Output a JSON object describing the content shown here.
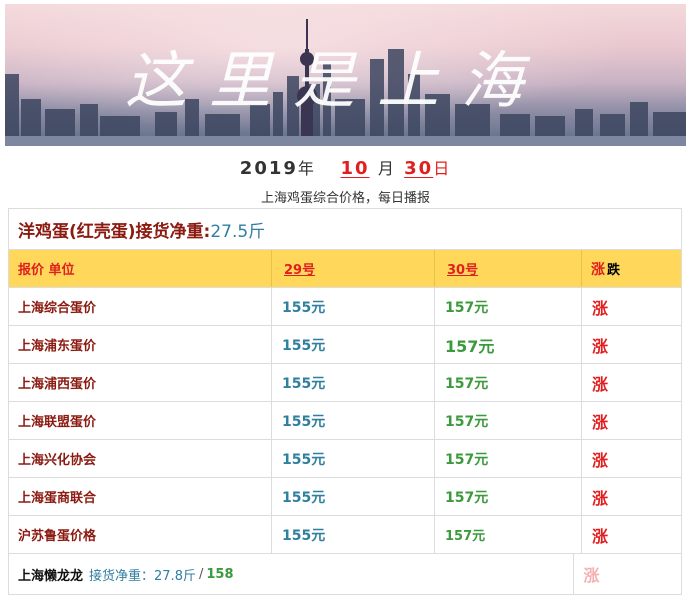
{
  "banner": {
    "calligraphy_text": "这里是上海"
  },
  "date": {
    "year": "2019",
    "year_unit": "年",
    "month": "10",
    "month_unit": "月",
    "day": "30",
    "day_unit": "日"
  },
  "subtitle": "上海鸡蛋综合价格，每日播报",
  "table": {
    "title": "洋鸡蛋(红壳蛋)接货净重:",
    "title_weight": "27.5斤",
    "header": {
      "col1": "报价 单位",
      "col2": "29号",
      "col3": "30号",
      "col4_rise": "涨",
      "col4_fall": "跌"
    },
    "rows": [
      {
        "name": "上海综合蛋价",
        "p29": "155元",
        "p30": "157元",
        "trend": "涨"
      },
      {
        "name": "上海浦东蛋价",
        "p29": "155元",
        "p30": "157元",
        "trend": "涨"
      },
      {
        "name": "上海浦西蛋价",
        "p29": "155元",
        "p30": "157元",
        "trend": "涨"
      },
      {
        "name": "上海联盟蛋价",
        "p29": "155元",
        "p30": "157元",
        "trend": "涨"
      },
      {
        "name": "上海兴化协会",
        "p29": "155元",
        "p30": "157元",
        "trend": "涨"
      },
      {
        "name": "上海蛋商联合",
        "p29": "155元",
        "p30": "157元",
        "trend": "涨"
      },
      {
        "name": "沪苏鲁蛋价格",
        "p29": "155元",
        "p30": "157元",
        "trend": "涨"
      }
    ],
    "footer": {
      "name": "上海懒龙龙",
      "label": "接货净重：27.8斤",
      "slash": "/",
      "price": "158",
      "trend": "涨"
    }
  }
}
